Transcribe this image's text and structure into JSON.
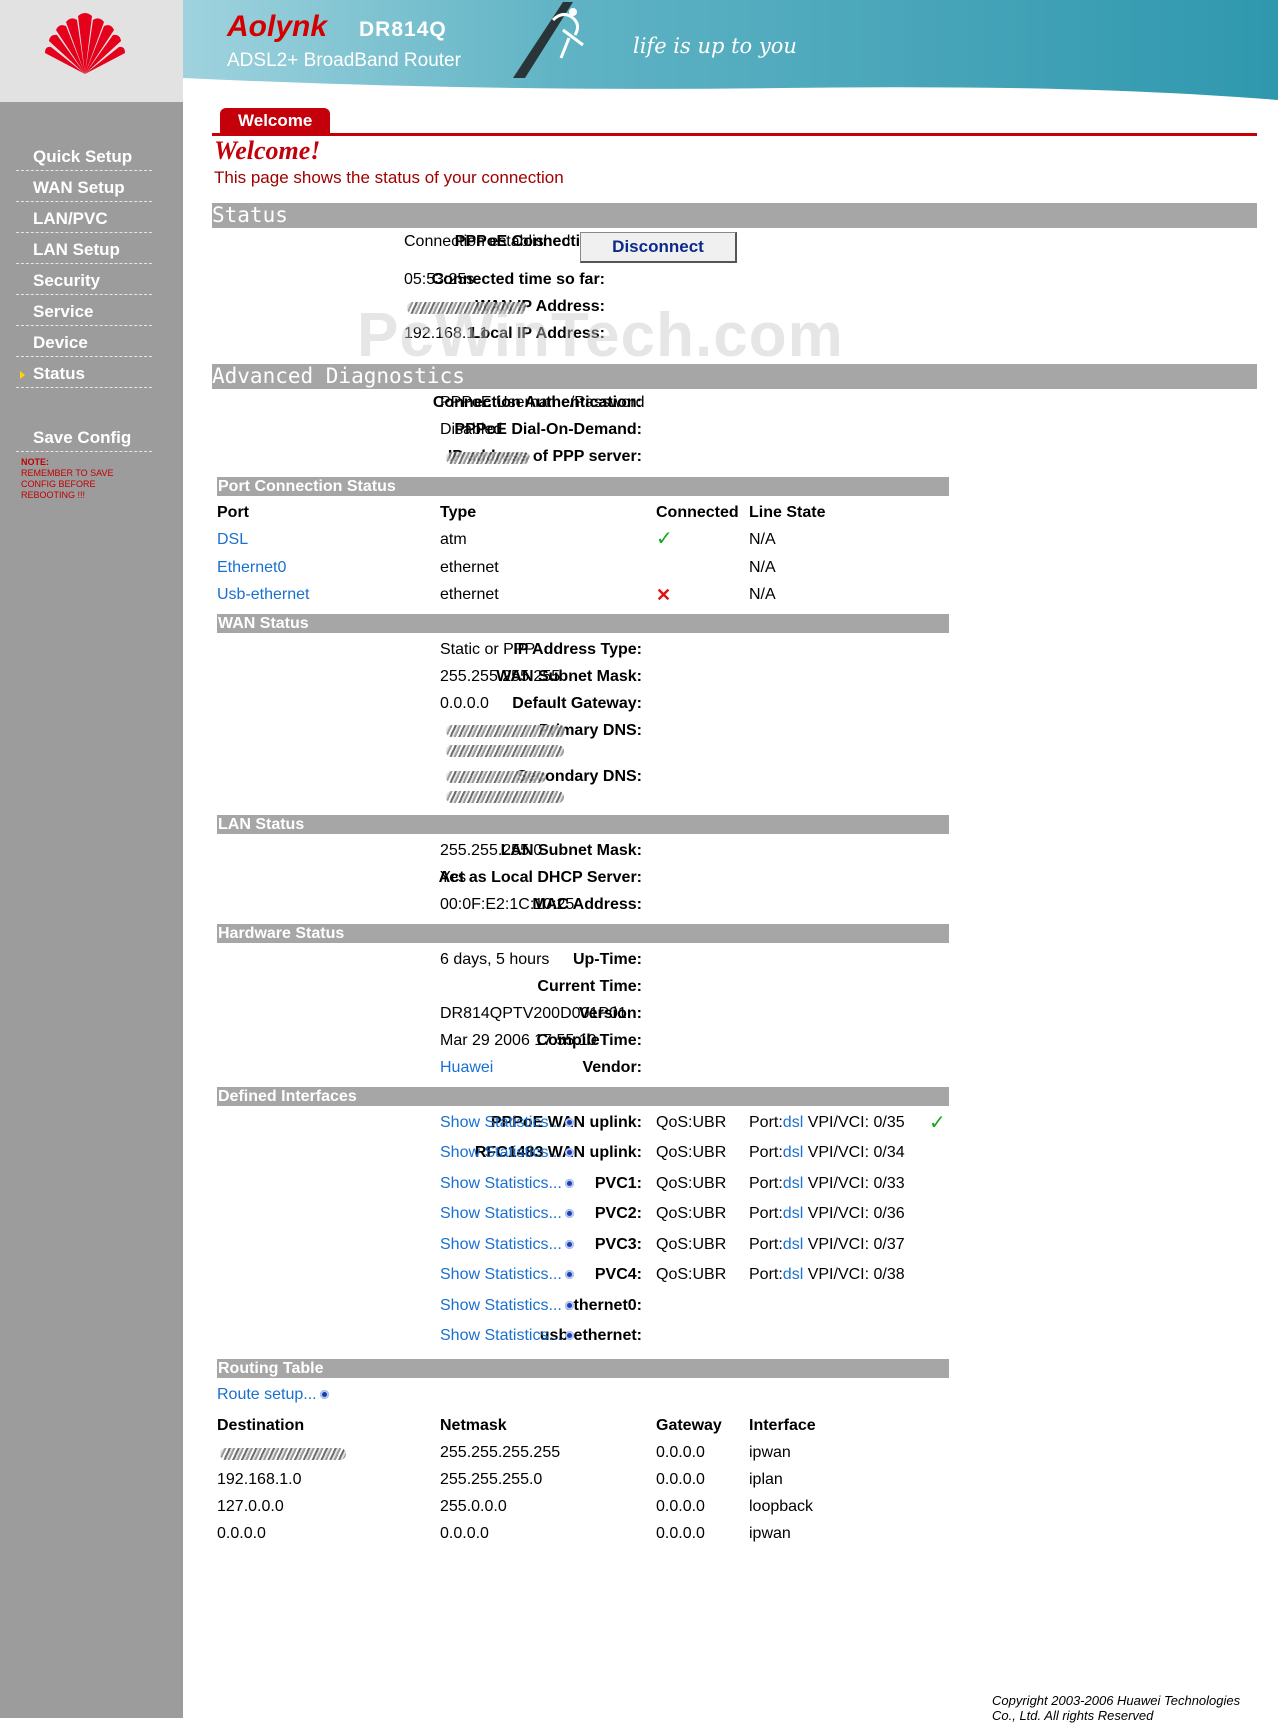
{
  "header": {
    "brand": "Aolynk",
    "model": "DR814Q",
    "subtitle": "ADSL2+ BroadBand Router",
    "slogan": "life is up to you",
    "colors": {
      "header_teal": "#3a9fb5",
      "accent_red": "#c4000a",
      "sidebar_gray": "#9c9c9c"
    }
  },
  "sidebar": {
    "items": [
      {
        "label": "Quick Setup"
      },
      {
        "label": "WAN Setup"
      },
      {
        "label": "LAN/PVC"
      },
      {
        "label": "LAN Setup"
      },
      {
        "label": "Security"
      },
      {
        "label": "Service"
      },
      {
        "label": "Device"
      },
      {
        "label": "Status"
      }
    ],
    "active": "Status",
    "save_config": "Save Config",
    "note_title": "NOTE:",
    "note_text": "REMEMBER TO SAVE CONFIG BEFORE REBOOTING !!!"
  },
  "tab": {
    "label": "Welcome"
  },
  "welcome": {
    "title": "Welcome!",
    "desc": "This page shows the status of your connection"
  },
  "status": {
    "title": "Status",
    "pppoe_label": "PPPoE Connection:",
    "pppoe_value": "Connection established",
    "disconnect": "Disconnect",
    "time_label": "Connected time so far:",
    "time_value": "05:53:25s",
    "wan_ip_label": "WAN IP Address:",
    "local_ip_label": "Local IP Address:",
    "local_ip_value": "192.168.1.1"
  },
  "watermark": "PcWinTech.com",
  "adv": {
    "title": "Advanced Diagnostics",
    "auth_label": "Connection Authentication:",
    "auth_value": "PPPoE Username/Password",
    "dod_label": "PPPoE Dial-On-Demand:",
    "dod_value": "Disabled",
    "pppserver_label": "IP address of PPP server:"
  },
  "ports": {
    "title": "Port Connection Status",
    "headers": [
      "Port",
      "Type",
      "Connected",
      "Line State"
    ],
    "rows": [
      {
        "port": "DSL",
        "type": "atm",
        "connected": "yes",
        "line": "N/A"
      },
      {
        "port": "Ethernet0",
        "type": "ethernet",
        "connected": "",
        "line": "N/A"
      },
      {
        "port": "Usb-ethernet",
        "type": "ethernet",
        "connected": "no",
        "line": "N/A"
      }
    ]
  },
  "wan": {
    "title": "WAN Status",
    "ip_type_label": "IP Address Type:",
    "ip_type_value": "Static or PPP",
    "mask_label": "WAN Subnet Mask:",
    "mask_value": "255.255.255.255",
    "gw_label": "Default Gateway:",
    "gw_value": "0.0.0.0",
    "dns1_label": "Primary DNS:",
    "dns2_label": "Secondary DNS:"
  },
  "lan": {
    "title": "LAN Status",
    "mask_label": "LAN Subnet Mask:",
    "mask_value": "255.255.255.0",
    "dhcp_label": "Act as Local DHCP Server:",
    "dhcp_value": "Yes",
    "mac_label": "MAC Address:",
    "mac_value": "00:0F:E2:1C:10:25"
  },
  "hardware": {
    "title": "Hardware Status",
    "uptime_label": "Up-Time:",
    "uptime_value": "6 days, 5 hours",
    "time_label": "Current Time:",
    "version_label": "Version:",
    "version_value": "DR814QPTV200D001P01",
    "compile_label": "CompileTime:",
    "compile_value": "Mar 29 2006 17:55:10",
    "vendor_label": "Vendor:",
    "vendor_value": "Huawei"
  },
  "interfaces": {
    "title": "Defined Interfaces",
    "show_stats": "Show Statistics...",
    "rows": [
      {
        "name": "PPPoE WAN uplink:",
        "qos": "QoS:UBR",
        "port_prefix": "Port:",
        "port_link": "dsl",
        "vpivci": "VPI/VCI: 0/35",
        "active": true
      },
      {
        "name": "RFC1483 WAN uplink:",
        "qos": "QoS:UBR",
        "port_prefix": "Port:",
        "port_link": "dsl",
        "vpivci": "VPI/VCI: 0/34",
        "active": false
      },
      {
        "name": "PVC1:",
        "qos": "QoS:UBR",
        "port_prefix": "Port:",
        "port_link": "dsl",
        "vpivci": "VPI/VCI: 0/33",
        "active": false
      },
      {
        "name": "PVC2:",
        "qos": "QoS:UBR",
        "port_prefix": "Port:",
        "port_link": "dsl",
        "vpivci": "VPI/VCI: 0/36",
        "active": false
      },
      {
        "name": "PVC3:",
        "qos": "QoS:UBR",
        "port_prefix": "Port:",
        "port_link": "dsl",
        "vpivci": "VPI/VCI: 0/37",
        "active": false
      },
      {
        "name": "PVC4:",
        "qos": "QoS:UBR",
        "port_prefix": "Port:",
        "port_link": "dsl",
        "vpivci": "VPI/VCI: 0/38",
        "active": false
      },
      {
        "name": "ethernet0:",
        "qos": "",
        "port_prefix": "",
        "port_link": "",
        "vpivci": "",
        "active": false
      },
      {
        "name": "usb-ethernet:",
        "qos": "",
        "port_prefix": "",
        "port_link": "",
        "vpivci": "",
        "active": false
      }
    ]
  },
  "routing": {
    "title": "Routing Table",
    "setup_link": "Route setup...",
    "headers": [
      "Destination",
      "Netmask",
      "Gateway",
      "Interface"
    ],
    "rows": [
      {
        "dest": "",
        "mask": "255.255.255.255",
        "gw": "0.0.0.0",
        "iface": "ipwan"
      },
      {
        "dest": "192.168.1.0",
        "mask": "255.255.255.0",
        "gw": "0.0.0.0",
        "iface": "iplan"
      },
      {
        "dest": "127.0.0.0",
        "mask": "255.0.0.0",
        "gw": "0.0.0.0",
        "iface": "loopback"
      },
      {
        "dest": "0.0.0.0",
        "mask": "0.0.0.0",
        "gw": "0.0.0.0",
        "iface": "ipwan"
      }
    ]
  },
  "footer": {
    "copyright": "Copyright 2003-2006 Huawei Technologies Co., Ltd. All rights Reserved"
  }
}
